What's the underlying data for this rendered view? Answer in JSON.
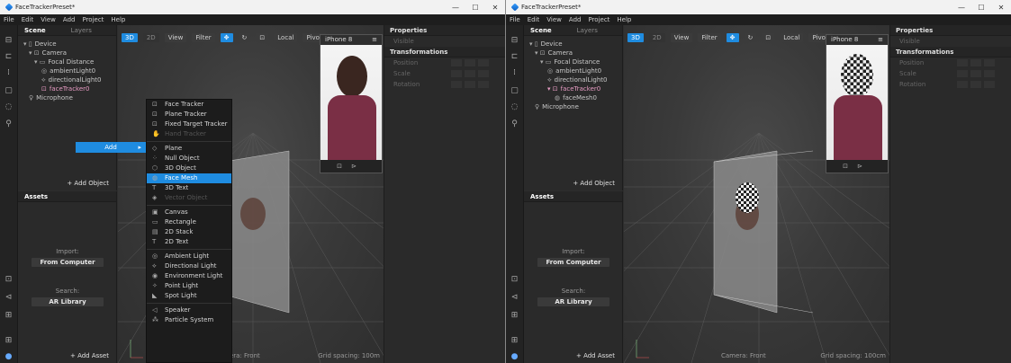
{
  "windows": [
    {
      "title": "FaceTrackerPreset*",
      "controls": [
        "—",
        "☐",
        "✕"
      ],
      "menu": [
        "File",
        "Edit",
        "View",
        "Add",
        "Project",
        "Help"
      ],
      "scene_tabs": [
        "Scene",
        "Layers"
      ],
      "tree": [
        {
          "label": "Device",
          "icon": "device-icon",
          "level": 0
        },
        {
          "label": "Camera",
          "icon": "camera-icon",
          "level": 1
        },
        {
          "label": "Focal Distance",
          "icon": "focal-icon",
          "level": 2
        },
        {
          "label": "ambientLight0",
          "icon": "light-icon",
          "level": 3
        },
        {
          "label": "directionalLight0",
          "icon": "directional-light-icon",
          "level": 3
        },
        {
          "label": "faceTracker0",
          "icon": "face-tracker-icon",
          "level": 3,
          "selected": true
        },
        {
          "label": "Microphone",
          "icon": "microphone-icon",
          "level": 1
        }
      ],
      "add_object": "+ Add Object",
      "assets_title": "Assets",
      "import_label": "Import:",
      "from_computer": "From Computer",
      "search_label": "Search:",
      "ar_library": "AR Library",
      "add_asset": "+ Add Asset",
      "toolbar": {
        "mode2d": "2D",
        "mode3d": "3D",
        "view": "View",
        "filter": "Filter",
        "local": "Local",
        "pivot": "Pivot"
      },
      "device": "iPhone 8",
      "camera_caption": "Camera: Front",
      "grid_caption": "Grid spacing: 100m",
      "props_title": "Properties",
      "visible": "Visible",
      "transformations": "Transformations",
      "position": "Position",
      "scale": "Scale",
      "rotation": "Rotation",
      "add_menu_label": "Add",
      "context_menu": [
        {
          "label": "Face Tracker",
          "icon": "face-tracker-icon"
        },
        {
          "label": "Plane Tracker",
          "icon": "plane-tracker-icon"
        },
        {
          "label": "Fixed Target Tracker",
          "icon": "target-icon"
        },
        {
          "label": "Hand Tracker",
          "icon": "hand-icon",
          "disabled": true
        },
        {
          "sep": true
        },
        {
          "label": "Plane",
          "icon": "plane-icon"
        },
        {
          "label": "Null Object",
          "icon": "null-object-icon"
        },
        {
          "label": "3D Object",
          "icon": "cube-icon"
        },
        {
          "label": "Face Mesh",
          "icon": "face-mesh-icon",
          "highlight": true
        },
        {
          "label": "3D Text",
          "icon": "text-icon"
        },
        {
          "label": "Vector Object",
          "icon": "vector-icon",
          "disabled": true
        },
        {
          "sep": true
        },
        {
          "label": "Canvas",
          "icon": "canvas-icon"
        },
        {
          "label": "Rectangle",
          "icon": "rectangle-icon"
        },
        {
          "label": "2D Stack",
          "icon": "stack-icon"
        },
        {
          "label": "2D Text",
          "icon": "text-icon"
        },
        {
          "sep": true
        },
        {
          "label": "Ambient Light",
          "icon": "light-icon"
        },
        {
          "label": "Directional Light",
          "icon": "directional-light-icon"
        },
        {
          "label": "Environment Light",
          "icon": "environment-light-icon"
        },
        {
          "label": "Point Light",
          "icon": "point-light-icon"
        },
        {
          "label": "Spot Light",
          "icon": "spot-light-icon"
        },
        {
          "sep": true
        },
        {
          "label": "Speaker",
          "icon": "speaker-icon"
        },
        {
          "label": "Particle System",
          "icon": "particle-icon"
        }
      ]
    },
    {
      "title": "FaceTrackerPreset*",
      "controls": [
        "—",
        "☐",
        "✕"
      ],
      "menu": [
        "File",
        "Edit",
        "View",
        "Add",
        "Project",
        "Help"
      ],
      "scene_tabs": [
        "Scene",
        "Layers"
      ],
      "tree": [
        {
          "label": "Device",
          "icon": "device-icon",
          "level": 0
        },
        {
          "label": "Camera",
          "icon": "camera-icon",
          "level": 1
        },
        {
          "label": "Focal Distance",
          "icon": "focal-icon",
          "level": 2
        },
        {
          "label": "ambientLight0",
          "icon": "light-icon",
          "level": 3
        },
        {
          "label": "directionalLight0",
          "icon": "directional-light-icon",
          "level": 3
        },
        {
          "label": "faceTracker0",
          "icon": "face-tracker-icon",
          "level": 3,
          "selected": true
        },
        {
          "label": "faceMesh0",
          "icon": "face-mesh-icon",
          "level": 4
        },
        {
          "label": "Microphone",
          "icon": "microphone-icon",
          "level": 1
        }
      ],
      "add_object": "+ Add Object",
      "assets_title": "Assets",
      "import_label": "Import:",
      "from_computer": "From Computer",
      "search_label": "Search:",
      "ar_library": "AR Library",
      "add_asset": "+ Add Asset",
      "toolbar": {
        "mode2d": "2D",
        "mode3d": "3D",
        "view": "View",
        "filter": "Filter",
        "local": "Local",
        "pivot": "Pivot"
      },
      "device": "iPhone 8",
      "camera_caption": "Camera: Front",
      "grid_caption": "Grid spacing: 100cm",
      "props_title": "Properties",
      "visible": "Visible",
      "transformations": "Transformations",
      "position": "Position",
      "scale": "Scale",
      "rotation": "Rotation"
    }
  ]
}
